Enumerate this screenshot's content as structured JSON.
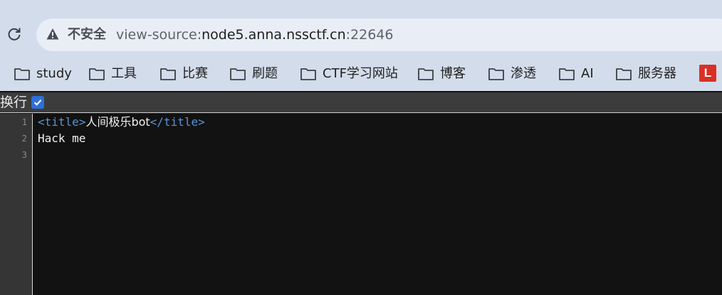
{
  "omnibox": {
    "security_label": "不安全",
    "url_prefix": "view-source:",
    "url_host": "node5.anna.nssctf.cn",
    "url_port": ":22646"
  },
  "bookmarks": [
    {
      "label": "study"
    },
    {
      "label": "工具"
    },
    {
      "label": "比赛"
    },
    {
      "label": "刷题"
    },
    {
      "label": "CTF学习网站"
    },
    {
      "label": "博客"
    },
    {
      "label": "渗透"
    },
    {
      "label": "AI"
    },
    {
      "label": "服务器"
    }
  ],
  "bookmark_badge": "L",
  "source_view": {
    "wrap_label": "换行",
    "wrap_checked": true,
    "line_numbers": [
      "1",
      "2",
      "3"
    ],
    "lines": {
      "line1_open_tag": "<title>",
      "line1_text": "人间极乐bot",
      "line1_close_tag": "</title>",
      "line2_text": "Hack me"
    }
  },
  "colors": {
    "chrome_bg": "#d3dcea",
    "omnibox_bg": "#e8edf6",
    "source_bg": "#121212",
    "tag_color": "#5a93d6",
    "checkbox": "#2f6fd6"
  }
}
